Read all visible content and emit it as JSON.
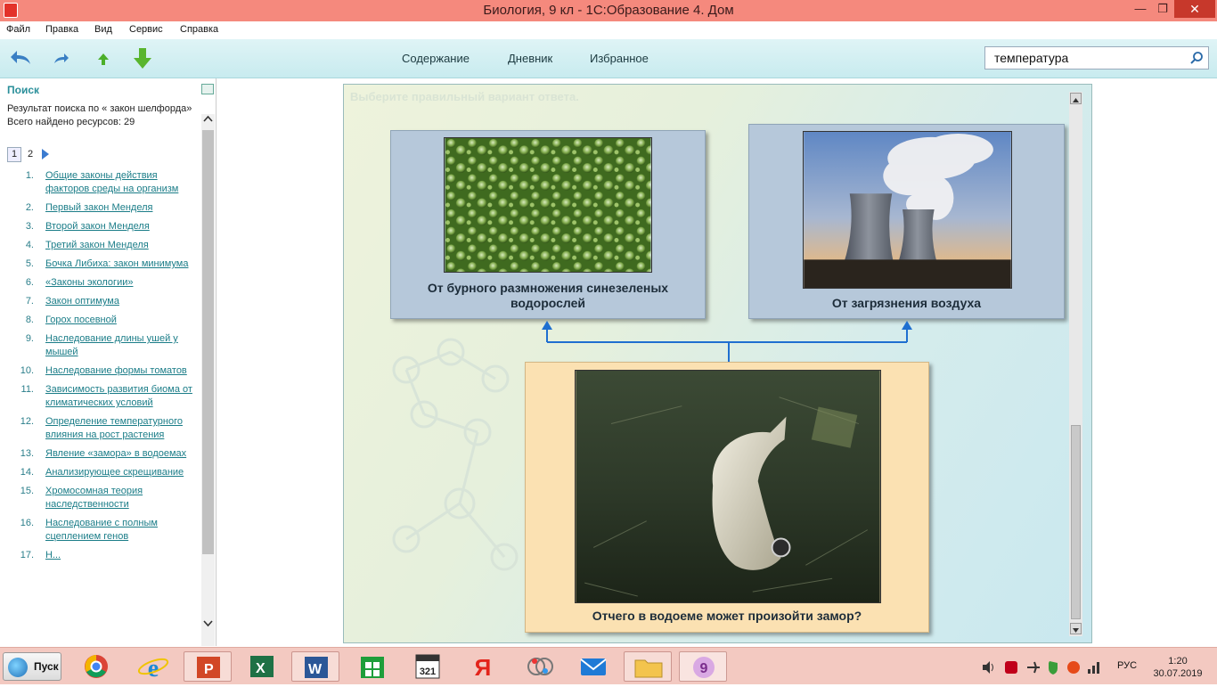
{
  "window": {
    "title": "Биология, 9 кл - 1С:Образование 4. Дом",
    "minimize_glyph": "—",
    "maximize_glyph": "❐",
    "close_glyph": "✕"
  },
  "menu": [
    "Файл",
    "Правка",
    "Вид",
    "Сервис",
    "Справка"
  ],
  "toolbar": {
    "nav": [
      "Содержание",
      "Дневник",
      "Избранное"
    ],
    "search_value": "температура",
    "icons": [
      "back-icon",
      "forward-icon",
      "up-icon",
      "download-icon",
      "search-icon"
    ]
  },
  "left_panel": {
    "title": "Поиск",
    "result_line": "Результат поиска по « закон шелфорда»",
    "found_line": "Всего найдено ресурсов: 29",
    "pages": [
      "1",
      "2"
    ],
    "results": [
      {
        "num": "1.",
        "text": "Общие законы действия факторов среды на организм"
      },
      {
        "num": "2.",
        "text": "Первый закон Менделя"
      },
      {
        "num": "3.",
        "text": "Второй закон Менделя"
      },
      {
        "num": "4.",
        "text": "Третий закон Менделя"
      },
      {
        "num": "5.",
        "text": "Бочка Либиха: закон минимума"
      },
      {
        "num": "6.",
        "text": "«Законы экологии»"
      },
      {
        "num": "7.",
        "text": "Закон оптимума"
      },
      {
        "num": "8.",
        "text": "Горох посевной"
      },
      {
        "num": "9.",
        "text": "Наследование длины ушей у мышей"
      },
      {
        "num": "10.",
        "text": "Наследование формы томатов"
      },
      {
        "num": "11.",
        "text": "Зависимость развития биома от климатических условий"
      },
      {
        "num": "12.",
        "text": "Определение температурного влияния на рост растения"
      },
      {
        "num": "13.",
        "text": "Явление «замора» в водоемах"
      },
      {
        "num": "14.",
        "text": "Анализирующее скрещивание"
      },
      {
        "num": "15.",
        "text": "Хромосомная теория наследственности"
      },
      {
        "num": "16.",
        "text": "Наследование с полным сцеплением генов"
      },
      {
        "num": "17.",
        "text": "Н..."
      }
    ]
  },
  "slide": {
    "prompt": "Выберите правильный вариант ответа.",
    "card1_caption": "От бурного размножения синезеленых водорослей",
    "card2_caption": "От загрязнения воздуха",
    "card3_caption": "Отчего в водоеме может произойти замор?"
  },
  "taskbar": {
    "start_label": "Пуск",
    "apps": [
      "chrome-icon",
      "internet-explorer-icon",
      "powerpoint-icon",
      "excel-icon",
      "word-icon",
      "store-icon",
      "calendar-icon",
      "yandex-icon",
      "paint-icon",
      "mail-icon",
      "folder-icon",
      "1c-icon"
    ],
    "calendar_day": "321",
    "yandex_letter": "Я",
    "lang": "РУС",
    "time": "1:20",
    "date": "30.07.2019",
    "colors": {
      "taskbar": "#f3c9c1",
      "titlebar": "#f5897d"
    }
  }
}
